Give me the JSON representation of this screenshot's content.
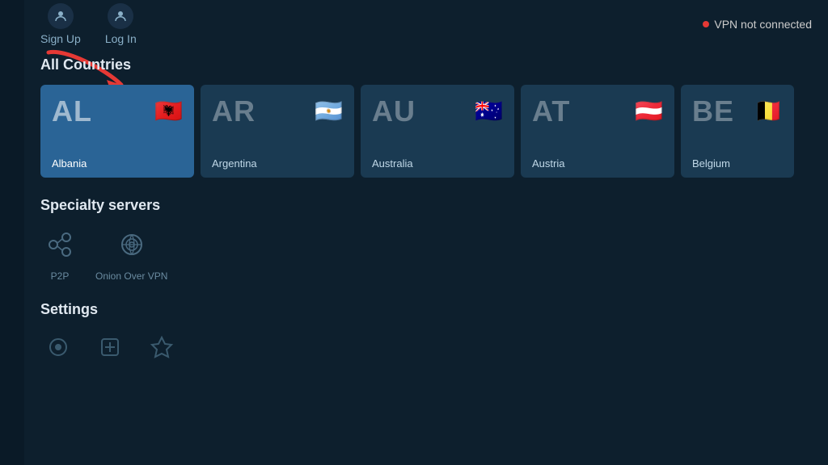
{
  "sidebar": {},
  "topbar": {
    "signup_label": "Sign Up",
    "login_label": "Log In",
    "vpn_status": "VPN not connected"
  },
  "countries_section": {
    "heading": "All Countries",
    "countries": [
      {
        "code": "AL",
        "name": "Albania",
        "flag": "🇦🇱",
        "selected": true
      },
      {
        "code": "AR",
        "name": "Argentina",
        "flag": "🇦🇷",
        "selected": false
      },
      {
        "code": "AU",
        "name": "Australia",
        "flag": "🇦🇺",
        "selected": false
      },
      {
        "code": "AT",
        "name": "Austria",
        "flag": "🇦🇹",
        "selected": false
      },
      {
        "code": "BE",
        "name": "Belgium",
        "flag": "🇧🇪",
        "selected": false
      }
    ]
  },
  "specialty_section": {
    "heading": "Specialty servers",
    "items": [
      {
        "label": "P2P",
        "icon": "p2p"
      },
      {
        "label": "Onion Over VPN",
        "icon": "onion"
      }
    ]
  },
  "settings_section": {
    "heading": "Settings"
  },
  "colors": {
    "accent": "#e53935",
    "bg_dark": "#0d1f2d",
    "bg_card": "#1a3a52",
    "bg_selected": "#2a6496"
  }
}
